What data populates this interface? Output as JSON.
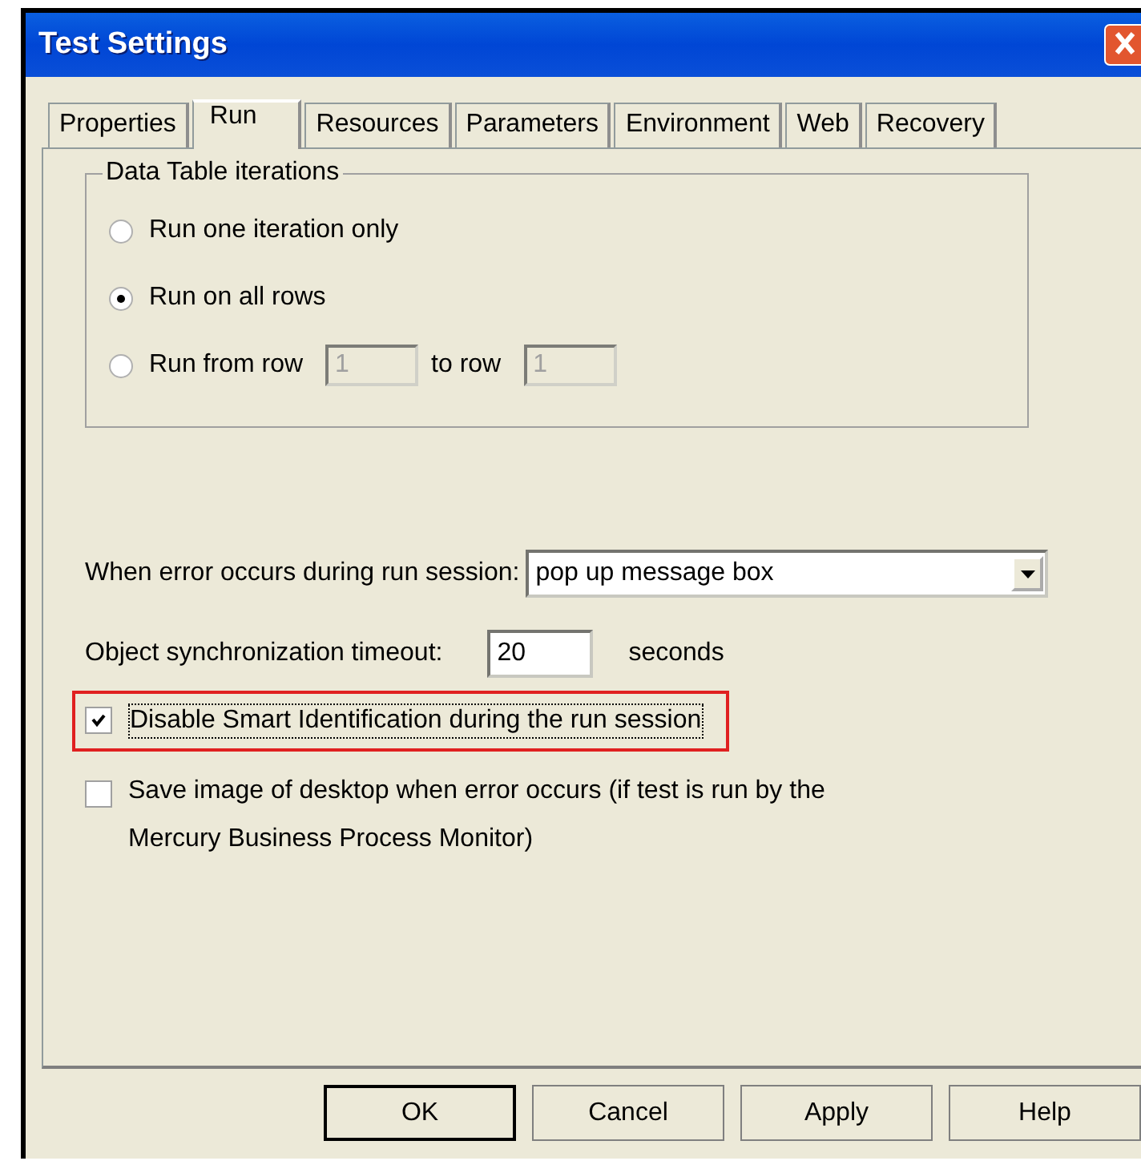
{
  "window": {
    "title": "Test Settings"
  },
  "tabs": [
    {
      "label": "Properties",
      "selected": false
    },
    {
      "label": "Run",
      "selected": true
    },
    {
      "label": "Resources",
      "selected": false
    },
    {
      "label": "Parameters",
      "selected": false
    },
    {
      "label": "Environment",
      "selected": false
    },
    {
      "label": "Web",
      "selected": false
    },
    {
      "label": "Recovery",
      "selected": false
    }
  ],
  "iterations": {
    "title": "Data Table iterations",
    "options": [
      {
        "kind": "plain",
        "label": "Run one iteration only",
        "selected": false
      },
      {
        "kind": "plain",
        "label": "Run on all rows",
        "selected": true
      },
      {
        "kind": "range",
        "label": "Run from row",
        "from": "1",
        "to_label": "to row",
        "to": "1",
        "selected": false
      }
    ]
  },
  "on_error": {
    "label": "When error occurs during run session:",
    "value": "pop up message box"
  },
  "timeout": {
    "label": "Object synchronization timeout:",
    "value": "20",
    "unit": "seconds"
  },
  "options": [
    {
      "label": "Disable Smart Identification during the run session",
      "checked": true,
      "highlighted": true
    },
    {
      "label": "Save image of desktop when error occurs (if test is run by the Mercury Business Process Monitor)",
      "checked": false,
      "highlighted": false
    }
  ],
  "buttons": [
    {
      "label": "OK",
      "default": true
    },
    {
      "label": "Cancel",
      "default": false
    },
    {
      "label": "Apply",
      "default": false
    },
    {
      "label": "Help",
      "default": false
    }
  ]
}
